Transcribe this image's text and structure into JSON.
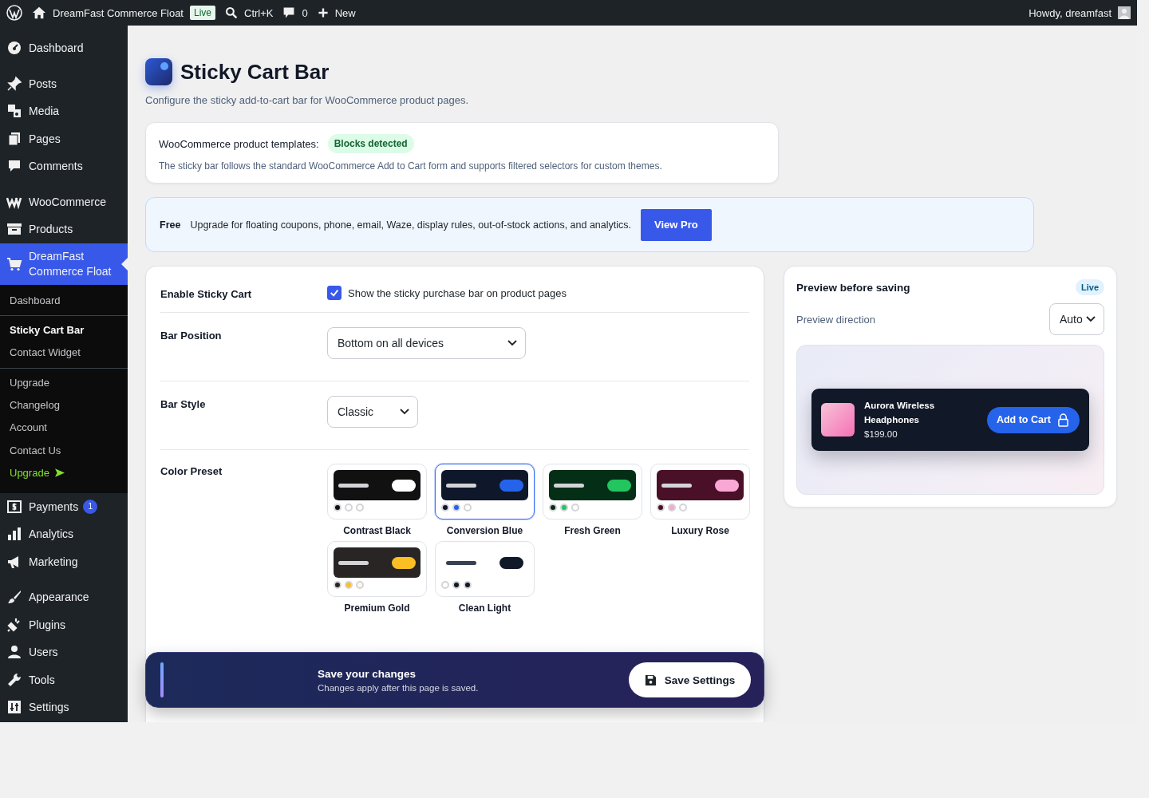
{
  "admin_bar": {
    "site_title": "DreamFast Commerce Float",
    "site_badge": "Live",
    "search_shortcut": "Ctrl+K",
    "comments_count": "0",
    "new_label": "New",
    "greeting": "Howdy, dreamfast"
  },
  "sidebar": {
    "groups": [
      [
        {
          "label": "Dashboard",
          "selected": false
        }
      ],
      [
        {
          "label": "Posts",
          "selected": false
        },
        {
          "label": "Media",
          "selected": false
        },
        {
          "label": "Pages",
          "selected": false
        },
        {
          "label": "Comments",
          "selected": false
        }
      ],
      [
        {
          "label": "WooCommerce",
          "selected": false
        },
        {
          "label": "Products",
          "selected": false
        },
        {
          "label": "DreamFast Commerce Float",
          "selected": true,
          "submenu": [
            [
              {
                "label": "Dashboard",
                "selected": false,
                "kind": "link"
              }
            ],
            [
              {
                "label": "Sticky Cart Bar",
                "selected": true,
                "kind": "link"
              },
              {
                "label": "Contact Widget",
                "selected": false,
                "kind": "link"
              }
            ],
            [
              {
                "label": "Upgrade",
                "selected": false,
                "kind": "link"
              },
              {
                "label": "Changelog",
                "selected": false,
                "kind": "link"
              },
              {
                "label": "Account",
                "selected": false,
                "kind": "link"
              },
              {
                "label": "Contact Us",
                "selected": false,
                "kind": "link"
              },
              {
                "label": "Upgrade",
                "selected": false,
                "kind": "promo"
              }
            ]
          ]
        },
        {
          "label": "Payments",
          "selected": false,
          "badge": "1"
        },
        {
          "label": "Analytics",
          "selected": false
        },
        {
          "label": "Marketing",
          "selected": false
        }
      ],
      [
        {
          "label": "Appearance",
          "selected": false
        },
        {
          "label": "Plugins",
          "selected": false
        },
        {
          "label": "Users",
          "selected": false
        },
        {
          "label": "Tools",
          "selected": false
        },
        {
          "label": "Settings",
          "selected": false
        }
      ]
    ]
  },
  "page": {
    "title": "Sticky Cart Bar",
    "subtitle": "Configure the sticky add-to-cart bar for WooCommerce product pages."
  },
  "notice": {
    "label": "WooCommerce product templates:",
    "badge": "Blocks detected",
    "text": "The sticky bar follows the standard WooCommerce Add to Cart form and supports filtered selectors for custom themes."
  },
  "upsell": {
    "tag": "Free",
    "text": "Upgrade for floating coupons, phone, email, Waze, display rules, out-of-stock actions, and analytics.",
    "button": "View Pro"
  },
  "settings": [
    {
      "kind": "checkbox",
      "label": "Enable Sticky Cart",
      "checked": true,
      "text": "Show the sticky purchase bar on product pages"
    },
    {
      "kind": "select",
      "label": "Bar Position",
      "value": "Bottom on all devices"
    },
    {
      "kind": "select",
      "label": "Bar Style",
      "value": "Classic"
    },
    {
      "kind": "presets",
      "label": "Color Preset",
      "presets": [
        {
          "name": "Contrast Black",
          "selected": false,
          "swatches": [
            {
              "color": "#111111"
            },
            {
              "color": "#ffffff"
            },
            {
              "color": "#ffffff"
            }
          ]
        },
        {
          "name": "Conversion Blue",
          "selected": true,
          "swatches": [
            {
              "color": "#0f172a"
            },
            {
              "color": "#2563eb"
            },
            {
              "color": "#ffffff"
            }
          ]
        },
        {
          "name": "Fresh Green",
          "selected": false,
          "swatches": [
            {
              "color": "#052e16"
            },
            {
              "color": "#22c55e"
            },
            {
              "color": "#ffffff"
            }
          ]
        },
        {
          "name": "Luxury Rose",
          "selected": false,
          "swatches": [
            {
              "color": "#4a1028"
            },
            {
              "color": "#f9a8d4"
            },
            {
              "color": "#ffffff"
            }
          ]
        },
        {
          "name": "Premium Gold",
          "selected": false,
          "swatches": [
            {
              "color": "#292524"
            },
            {
              "color": "#fbbf24"
            },
            {
              "color": "#fff7ed"
            }
          ]
        },
        {
          "name": "Clean Light",
          "selected": false,
          "swatches": [
            {
              "color": "#ffffff"
            },
            {
              "color": "#111827"
            },
            {
              "color": "#111827"
            }
          ]
        }
      ]
    }
  ],
  "preview": {
    "title": "Preview before saving",
    "badge": "Live",
    "direction_label": "Preview direction",
    "direction_value": "Auto",
    "product_name": "Aurora Wireless Headphones",
    "price": "$199.00",
    "button": "Add to Cart"
  },
  "save_bar": {
    "title": "Save your changes",
    "text": "Changes apply after this page is saved.",
    "button": "Save Settings"
  }
}
